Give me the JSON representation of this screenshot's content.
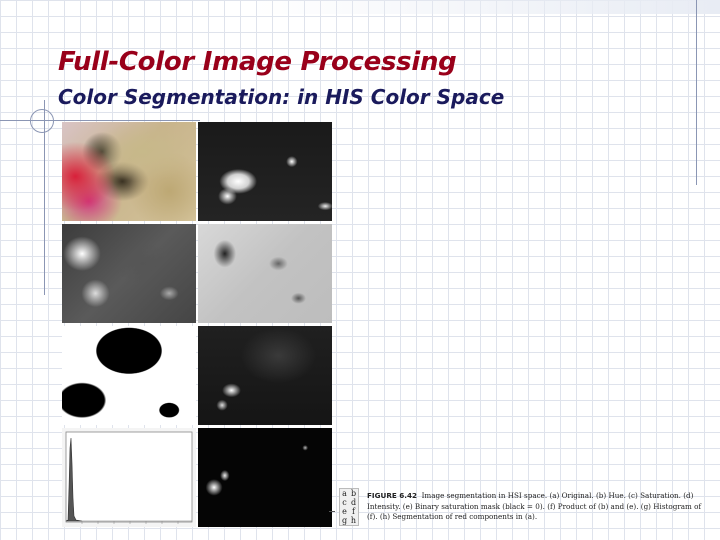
{
  "slide": {
    "title": "Full-Color Image Processing",
    "subtitle": "Color Segmentation: in HIS Color Space"
  },
  "figure": {
    "panels": [
      {
        "id": "a",
        "label": "Original"
      },
      {
        "id": "b",
        "label": "Hue"
      },
      {
        "id": "c",
        "label": "Saturation"
      },
      {
        "id": "d",
        "label": "Intensity"
      },
      {
        "id": "e",
        "label": "Binary saturation mask"
      },
      {
        "id": "f",
        "label": "Product of (b) and (e)"
      },
      {
        "id": "g",
        "label": "Histogram of (f)"
      },
      {
        "id": "h",
        "label": "Segmentation of red components in (a)"
      }
    ],
    "letter_key": [
      "a",
      "b",
      "c",
      "d",
      "e",
      "f",
      "g",
      "h"
    ],
    "caption_label": "FIGURE 6.42",
    "caption_text": "Image segmentation in HSI space. (a) Original. (b) Hue. (c) Saturation. (d) Intensity. (e) Binary saturation mask (black = 0). (f) Product of (b) and (e). (g) Histogram of (f). (h) Segmentation of red components in (a)."
  },
  "colors": {
    "title": "#99001a",
    "subtitle": "#1a1a5c",
    "grid": "#dfe3ec",
    "rule": "#8b96b4"
  }
}
